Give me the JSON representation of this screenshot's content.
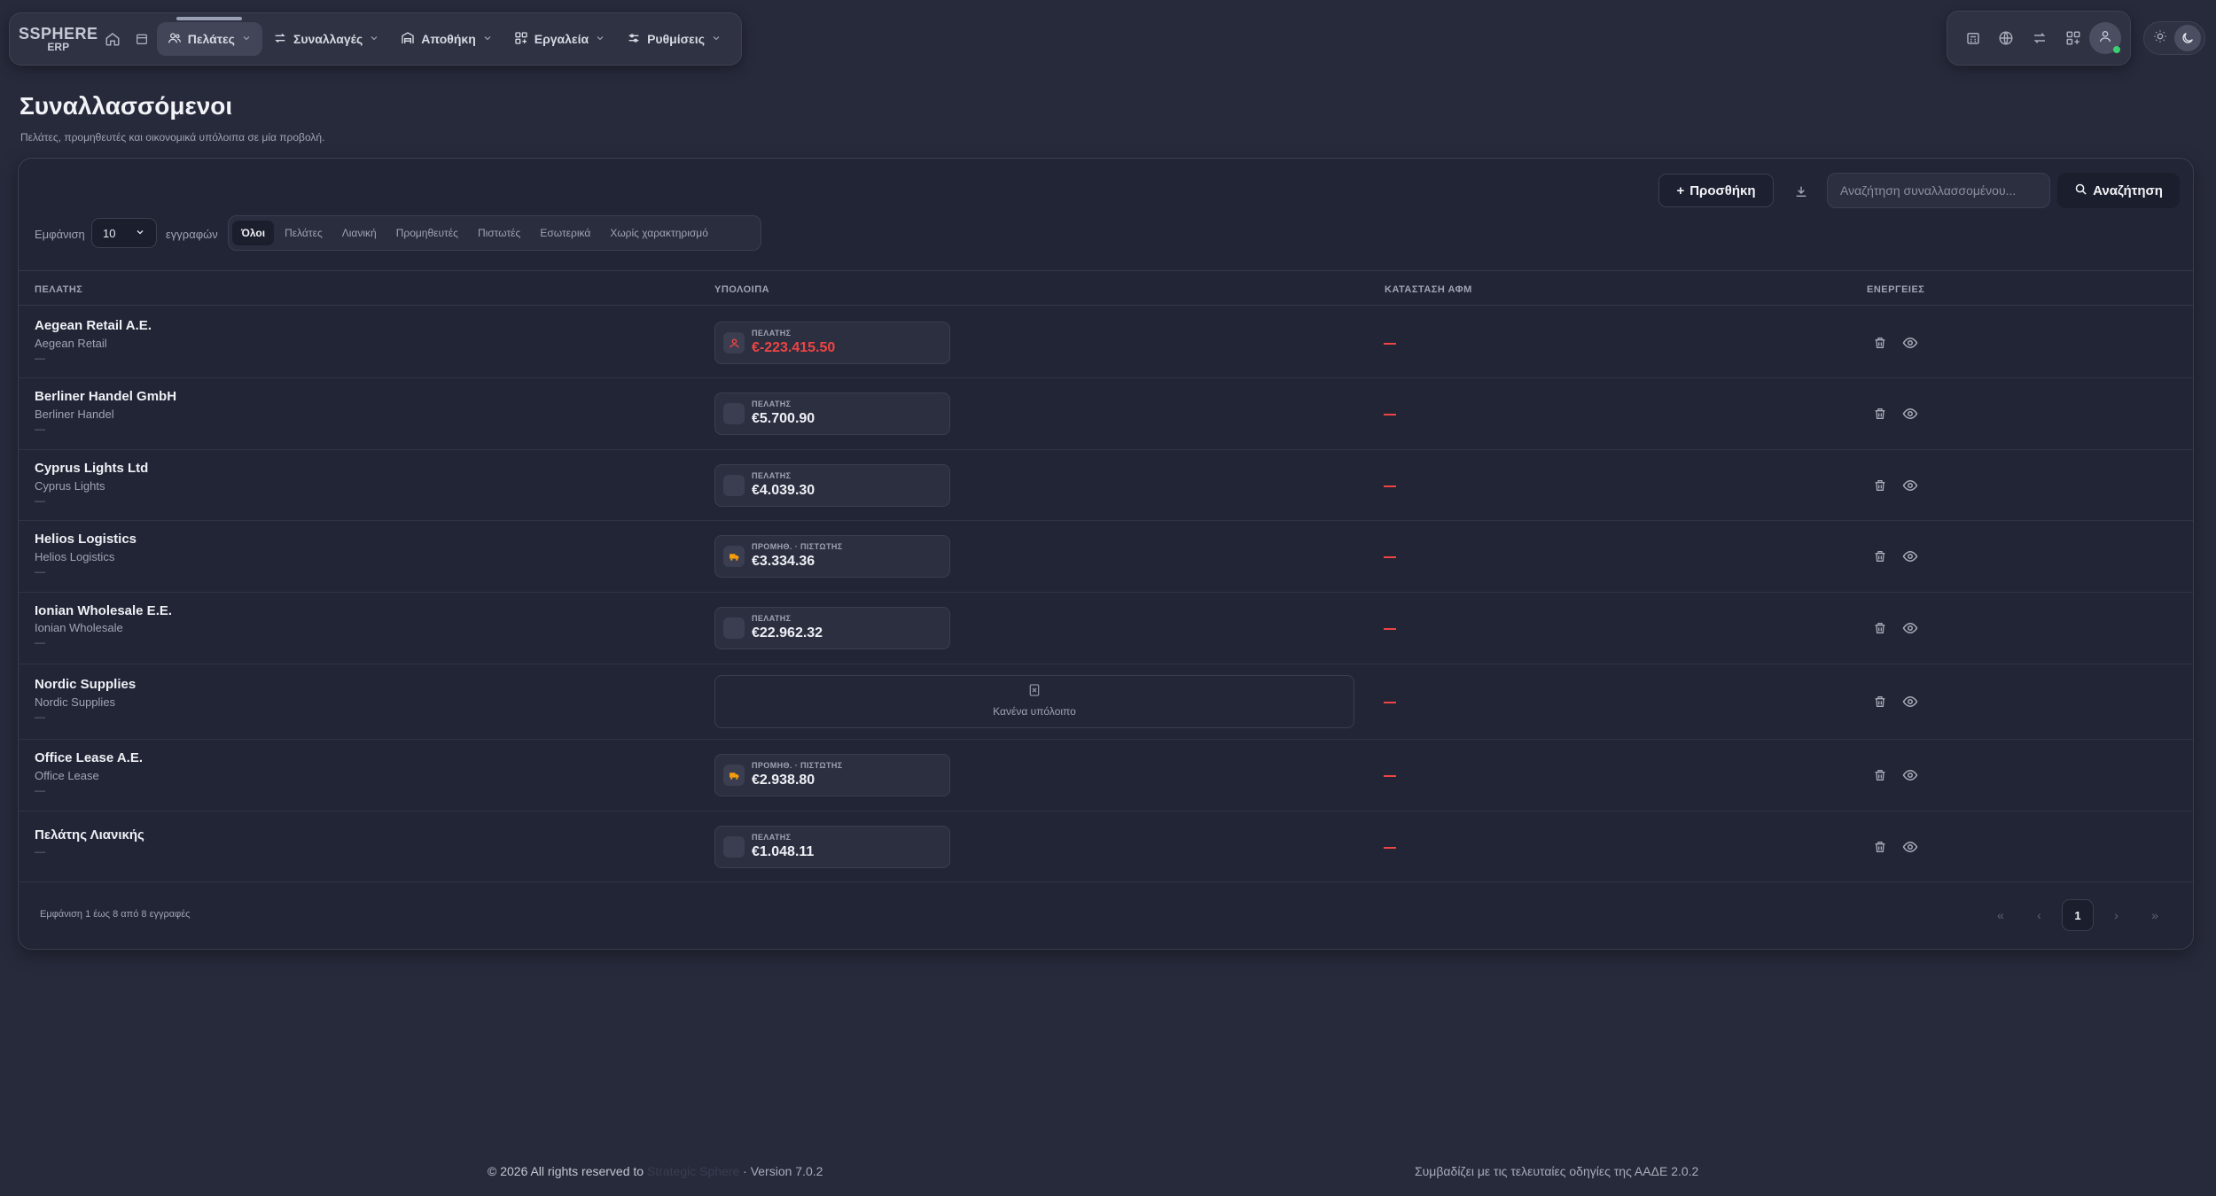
{
  "nav": {
    "logo_line1": "SSPHERE",
    "logo_line2": "ERP",
    "items": [
      {
        "label": "Πελάτες",
        "icon": "users-icon",
        "active": true
      },
      {
        "label": "Συναλλαγές",
        "icon": "arrows-exchange-icon",
        "active": false
      },
      {
        "label": "Αποθήκη",
        "icon": "warehouse-icon",
        "active": false
      },
      {
        "label": "Εργαλεία",
        "icon": "tools-grid-icon",
        "active": false
      },
      {
        "label": "Ρυθμίσεις",
        "icon": "sliders-icon",
        "active": false
      }
    ]
  },
  "page": {
    "title": "Συναλλασσόμενοι",
    "subtitle": "Πελάτες, προμηθευτές και οικονομικά υπόλοιπα σε μία προβολή."
  },
  "toolbar": {
    "add_label": "Προσθήκη",
    "search_placeholder": "Αναζήτηση συναλλασσομένου...",
    "search_button": "Αναζήτηση",
    "show_label": "Εμφάνιση",
    "page_size": "10",
    "records_label": "εγγραφών"
  },
  "filters": [
    "Όλοι",
    "Πελάτες",
    "Λιανική",
    "Προμηθευτές",
    "Πιστωτές",
    "Εσωτερικά",
    "Χωρίς χαρακτηρισμό"
  ],
  "columns": {
    "customer": "ΠΕΛΑΤΗΣ",
    "balances": "ΥΠΟΛΟΙΠΑ",
    "vat_status": "ΚΑΤΑΣΤΑΣΗ ΑΦΜ",
    "actions": "ΕΝΕΡΓΕΙΕΣ"
  },
  "rows": [
    {
      "name": "Aegean Retail A.E.",
      "alias": "Aegean Retail",
      "dash": "—",
      "balance_label": "ΠΕΛΑΤΗΣ",
      "balance": "€-223.415.50",
      "negative": true
    },
    {
      "name": "Berliner Handel GmbH",
      "alias": "Berliner Handel",
      "dash": "—",
      "balance_label": "ΠΕΛΑΤΗΣ",
      "balance": "€5.700.90",
      "negative": false
    },
    {
      "name": "Cyprus Lights Ltd",
      "alias": "Cyprus Lights",
      "dash": "—",
      "balance_label": "ΠΕΛΑΤΗΣ",
      "balance": "€4.039.30",
      "negative": false
    },
    {
      "name": "Helios Logistics",
      "alias": "Helios Logistics",
      "dash": "—",
      "balance_label": "ΠΡΟΜΗΘ. · ΠΙΣΤΩΤΗΣ",
      "balance": "€3.334.36",
      "negative": false
    },
    {
      "name": "Ionian Wholesale E.E.",
      "alias": "Ionian Wholesale",
      "dash": "—",
      "balance_label": "ΠΕΛΑΤΗΣ",
      "balance": "€22.962.32",
      "negative": false
    },
    {
      "name": "Nordic Supplies",
      "alias": "Nordic Supplies",
      "dash": "—",
      "empty_label": "Κανένα υπόλοιπο"
    },
    {
      "name": "Office Lease A.E.",
      "alias": "Office Lease",
      "dash": "—",
      "balance_label": "ΠΡΟΜΗΘ. · ΠΙΣΤΩΤΗΣ",
      "balance": "€2.938.80",
      "negative": false
    },
    {
      "name": "Πελάτης Λιανικής",
      "alias": "",
      "dash": "—",
      "balance_label": "ΠΕΛΑΤΗΣ",
      "balance": "€1.048.11",
      "negative": false
    }
  ],
  "pagination": {
    "info": "Εμφάνιση 1 έως 8 από 8 εγγραφές",
    "current_page": "1",
    "first": "«",
    "prev": "‹",
    "next": "›",
    "last": "»"
  },
  "footer": {
    "copyright": "© 2026 All rights reserved to",
    "brand": "Strategic Sphere",
    "version": "· Version 7.0.2",
    "aade_note": "Συμβαδίζει με τις τελευταίες οδηγίες της ΑΑΔΕ 2.0.2"
  },
  "colors": {
    "background": "#272a3b",
    "card": "#222535",
    "negative": "#ef4444",
    "online": "#3bd16f",
    "supplier_icon": "#f59e0b"
  }
}
